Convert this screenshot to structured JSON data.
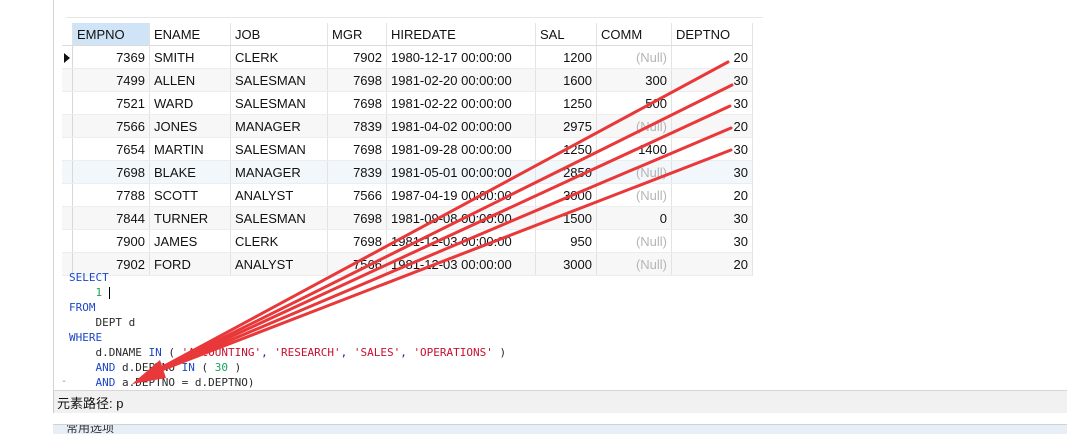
{
  "grid": {
    "columns": [
      "EMPNO",
      "ENAME",
      "JOB",
      "MGR",
      "HIREDATE",
      "SAL",
      "COMM",
      "DEPTNO"
    ],
    "selected_column": "EMPNO",
    "rows": [
      {
        "empno": "7369",
        "ename": "SMITH",
        "job": "CLERK",
        "mgr": "7902",
        "hiredate": "1980-12-17 00:00:00",
        "sal": "1200",
        "comm": "(Null)",
        "deptno": "20"
      },
      {
        "empno": "7499",
        "ename": "ALLEN",
        "job": "SALESMAN",
        "mgr": "7698",
        "hiredate": "1981-02-20 00:00:00",
        "sal": "1600",
        "comm": "300",
        "deptno": "30"
      },
      {
        "empno": "7521",
        "ename": "WARD",
        "job": "SALESMAN",
        "mgr": "7698",
        "hiredate": "1981-02-22 00:00:00",
        "sal": "1250",
        "comm": "500",
        "deptno": "30"
      },
      {
        "empno": "7566",
        "ename": "JONES",
        "job": "MANAGER",
        "mgr": "7839",
        "hiredate": "1981-04-02 00:00:00",
        "sal": "2975",
        "comm": "(Null)",
        "deptno": "20"
      },
      {
        "empno": "7654",
        "ename": "MARTIN",
        "job": "SALESMAN",
        "mgr": "7698",
        "hiredate": "1981-09-28 00:00:00",
        "sal": "1250",
        "comm": "1400",
        "deptno": "30"
      },
      {
        "empno": "7698",
        "ename": "BLAKE",
        "job": "MANAGER",
        "mgr": "7839",
        "hiredate": "1981-05-01 00:00:00",
        "sal": "2850",
        "comm": "(Null)",
        "deptno": "30"
      },
      {
        "empno": "7788",
        "ename": "SCOTT",
        "job": "ANALYST",
        "mgr": "7566",
        "hiredate": "1987-04-19 00:00:00",
        "sal": "3000",
        "comm": "(Null)",
        "deptno": "20"
      },
      {
        "empno": "7844",
        "ename": "TURNER",
        "job": "SALESMAN",
        "mgr": "7698",
        "hiredate": "1981-09-08 00:00:00",
        "sal": "1500",
        "comm": "0",
        "deptno": "30"
      },
      {
        "empno": "7900",
        "ename": "JAMES",
        "job": "CLERK",
        "mgr": "7698",
        "hiredate": "1981-12-03 00:00:00",
        "sal": "950",
        "comm": "(Null)",
        "deptno": "30"
      },
      {
        "empno": "7902",
        "ename": "FORD",
        "job": "ANALYST",
        "mgr": "7566",
        "hiredate": "1981-12-03 00:00:00",
        "sal": "3000",
        "comm": "(Null)",
        "deptno": "20"
      }
    ]
  },
  "sql": {
    "select_kw": "SELECT",
    "select_value": "1",
    "from_kw": "FROM",
    "from_table": "DEPT d",
    "where_kw": "WHERE",
    "line1_col": "d.DNAME",
    "in_kw": "IN",
    "line1_open": "(",
    "str1": "'ACCOUNTING'",
    "str2": "'RESEARCH'",
    "str3": "'SALES'",
    "str4": "'OPERATIONS'",
    "line1_close": ")",
    "and_kw": "AND",
    "line2_col": "d.DEPTNO",
    "line2_in": "IN",
    "line2_open": "(",
    "line2_num": "30",
    "line2_close": ")",
    "line3_expr": "a.DEPTNO = d.DEPTNO)"
  },
  "status_bar": {
    "label": "元素路径: p"
  },
  "bottom_panel": {
    "label": "常用选项"
  },
  "annotation": {
    "arrow_color": "#e8383a"
  }
}
